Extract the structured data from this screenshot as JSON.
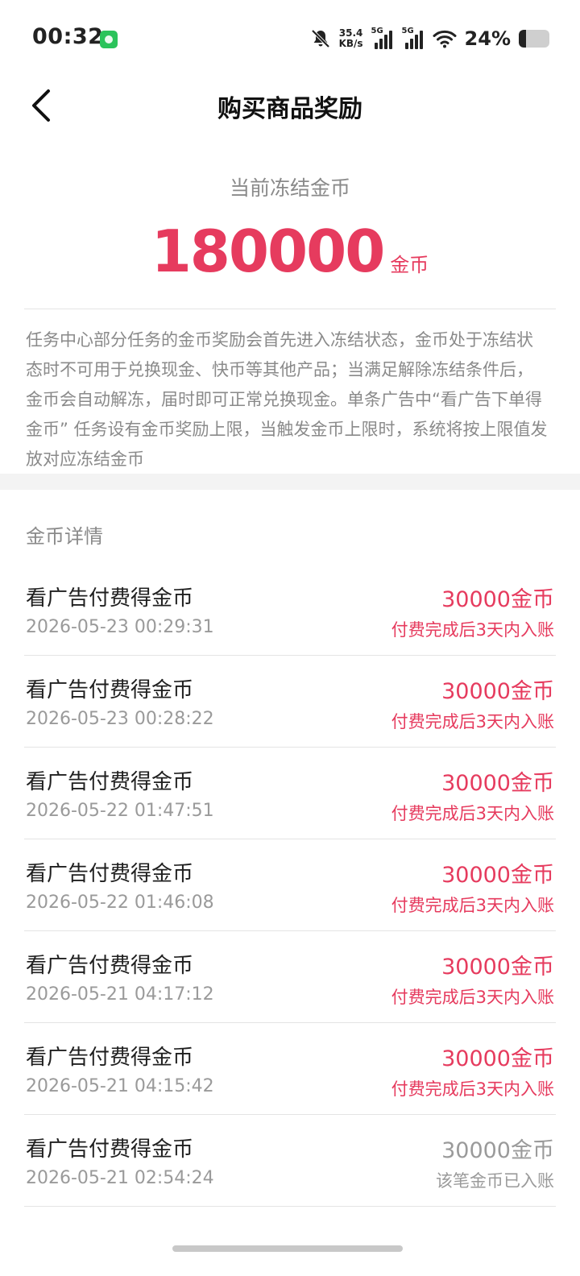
{
  "status_bar": {
    "time": "00:32",
    "net_speed_value": "35.4",
    "net_speed_unit": "KB/s",
    "signal1_label": "5G",
    "signal2_label": "5G",
    "battery_percent": "24%",
    "battery_level": 0.24,
    "icons": [
      "wechat-badge-icon",
      "mute-bell-icon",
      "signal-icon",
      "wifi-icon",
      "battery-icon"
    ]
  },
  "nav": {
    "back_icon": "chevron-left-icon",
    "title": "购买商品奖励"
  },
  "summary": {
    "label": "当前冻结金币",
    "amount": "180000",
    "unit": "金币"
  },
  "notice": "任务中心部分任务的金币奖励会首先进入冻结状态，金币处于冻结状态时不可用于兑换现金、快币等其他产品；当满足解除冻结条件后，金币会自动解冻，届时即可正常兑换现金。单条广告中“看广告下单得金币” 任务设有金币奖励上限，当触发金币上限时，系统将按上限值发放对应冻结金币",
  "section_title": "金币详情",
  "records": [
    {
      "title": "看广告付费得金币",
      "time": "2026-05-23 00:29:31",
      "amount": "30000金币",
      "status": "付费完成后3天内入账",
      "settled": false
    },
    {
      "title": "看广告付费得金币",
      "time": "2026-05-23 00:28:22",
      "amount": "30000金币",
      "status": "付费完成后3天内入账",
      "settled": false
    },
    {
      "title": "看广告付费得金币",
      "time": "2026-05-22 01:47:51",
      "amount": "30000金币",
      "status": "付费完成后3天内入账",
      "settled": false
    },
    {
      "title": "看广告付费得金币",
      "time": "2026-05-22 01:46:08",
      "amount": "30000金币",
      "status": "付费完成后3天内入账",
      "settled": false
    },
    {
      "title": "看广告付费得金币",
      "time": "2026-05-21 04:17:12",
      "amount": "30000金币",
      "status": "付费完成后3天内入账",
      "settled": false
    },
    {
      "title": "看广告付费得金币",
      "time": "2026-05-21 04:15:42",
      "amount": "30000金币",
      "status": "付费完成后3天内入账",
      "settled": false
    },
    {
      "title": "看广告付费得金币",
      "time": "2026-05-21 02:54:24",
      "amount": "30000金币",
      "status": "该笔金币已入账",
      "settled": true
    }
  ],
  "colors": {
    "accent": "#e63b5e",
    "muted_text": "#8a8a8a",
    "divider": "#e4e4e4"
  }
}
